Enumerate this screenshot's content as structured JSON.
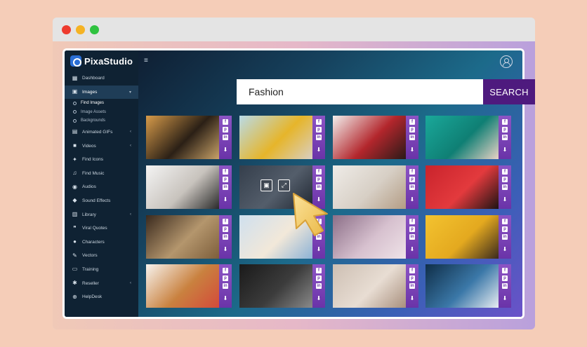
{
  "app": {
    "name": "PixaStudio"
  },
  "colors": {
    "accent": "#4e1a7e",
    "strip": "#7a44b8",
    "sidebar": "#0f2233"
  },
  "sidebar": {
    "items": [
      {
        "label": "Dashboard",
        "icon": "dashboard-icon"
      },
      {
        "label": "Images",
        "icon": "image-icon",
        "active": true
      },
      {
        "label": "Animated GIFs",
        "icon": "gif-icon"
      },
      {
        "label": "Videos",
        "icon": "video-icon"
      },
      {
        "label": "Find Icons",
        "icon": "sparkle-icon"
      },
      {
        "label": "Find Music",
        "icon": "music-icon"
      },
      {
        "label": "Audios",
        "icon": "audio-icon"
      },
      {
        "label": "Sound Effects",
        "icon": "sound-icon"
      },
      {
        "label": "Library",
        "icon": "library-icon"
      },
      {
        "label": "Viral Quotes",
        "icon": "quote-icon"
      },
      {
        "label": "Characters",
        "icon": "character-icon"
      },
      {
        "label": "Vectors",
        "icon": "pen-icon"
      },
      {
        "label": "Training",
        "icon": "monitor-icon"
      },
      {
        "label": "Reseller",
        "icon": "reseller-icon"
      },
      {
        "label": "HelpDesk",
        "icon": "help-icon"
      }
    ],
    "images_sub": [
      {
        "label": "Find Images",
        "current": true
      },
      {
        "label": "Image Assets"
      },
      {
        "label": "Backgrounds"
      }
    ]
  },
  "search": {
    "value": "Fashion",
    "button_label": "SEARCH"
  },
  "share": {
    "facebook": "f",
    "pinterest": "p",
    "linkedin": "in"
  },
  "results": [
    {
      "colors": [
        "#d79b4a",
        "#2b2016",
        "#c8a268"
      ]
    },
    {
      "colors": [
        "#b9dbe8",
        "#e6b52a",
        "#d9cfc3"
      ]
    },
    {
      "colors": [
        "#f2f0ee",
        "#b3262c",
        "#2a1a18"
      ]
    },
    {
      "colors": [
        "#1aa89a",
        "#0f7f74",
        "#e9d2c5"
      ]
    },
    {
      "colors": [
        "#f4f4f4",
        "#c8c3bd",
        "#2a2a2a"
      ]
    },
    {
      "colors": [
        "#4d5967",
        "#7d8997",
        "#2c343e"
      ]
    },
    {
      "colors": [
        "#efece8",
        "#d7cfc5",
        "#b39c84"
      ]
    },
    {
      "colors": [
        "#c9232c",
        "#e33a3d",
        "#1d1414"
      ]
    },
    {
      "colors": [
        "#3a2a1e",
        "#b4966d",
        "#7d5e3b"
      ]
    },
    {
      "colors": [
        "#cfe0ef",
        "#f2e8d9",
        "#8cb2d6"
      ]
    },
    {
      "colors": [
        "#8c6f88",
        "#d7c1cf",
        "#efe3e8"
      ]
    },
    {
      "colors": [
        "#f3c330",
        "#e4a91f",
        "#3a2a1e"
      ]
    },
    {
      "colors": [
        "#f7f3ee",
        "#c9813f",
        "#d44a3a"
      ]
    },
    {
      "colors": [
        "#1a1a1a",
        "#3c3c3c",
        "#8a8a8a"
      ]
    },
    {
      "colors": [
        "#cdbfb3",
        "#e8ddd3",
        "#a88f7d"
      ]
    },
    {
      "colors": [
        "#0f2e48",
        "#3b78a8",
        "#e8edf2"
      ]
    }
  ],
  "hover_card": 5,
  "overlay_icons": {
    "left": "preview-icon",
    "right": "edit-icon"
  }
}
